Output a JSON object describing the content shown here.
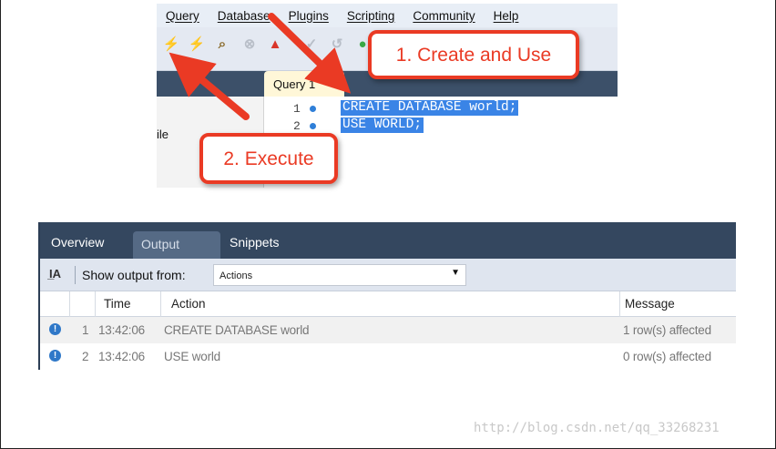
{
  "menu": {
    "items": [
      "Query",
      "Database",
      "Plugins",
      "Scripting",
      "Community",
      "Help"
    ]
  },
  "toolbar": {
    "icons": [
      "execute-icon",
      "execute-current-icon",
      "find-icon",
      "stop-icon",
      "commit-icon",
      "rollback-icon",
      "beautify-icon"
    ]
  },
  "sidebar": {
    "partial_text": "ile"
  },
  "query_tab": {
    "label": "Query 1",
    "close": "×"
  },
  "editor": {
    "line_numbers": [
      "1",
      "2"
    ],
    "lines": [
      "CREATE DATABASE world;",
      "USE WORLD;"
    ]
  },
  "callouts": {
    "create": "1. Create and Use",
    "execute": "2. Execute"
  },
  "output": {
    "tabs": [
      "Overview",
      "Output",
      "Snippets"
    ],
    "show_output_label": "Show output from:",
    "source_value": "Actions",
    "columns": [
      "Time",
      "Action",
      "Message"
    ],
    "rows": [
      {
        "index": "1",
        "time": "13:42:06",
        "action": "CREATE DATABASE world",
        "message": "1 row(s) affected"
      },
      {
        "index": "2",
        "time": "13:42:06",
        "action": "USE world",
        "message": "0 row(s) affected"
      }
    ]
  },
  "watermark": "http://blog.csdn.net/qq_33268231",
  "colors": {
    "callout_red": "#ea3a24",
    "selection_blue": "#3a84e6",
    "panel_dark": "#34475f"
  }
}
